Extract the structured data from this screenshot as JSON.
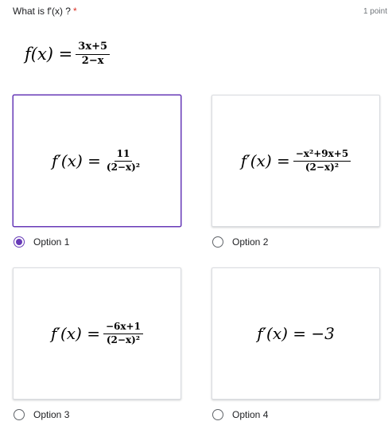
{
  "question": {
    "title": "What is f'(x) ?",
    "required_mark": "*",
    "points": "1 point",
    "expression_lhs": "f(x) =",
    "numerator": "3x+5",
    "denominator": "2−x"
  },
  "options": [
    {
      "label": "Option 1",
      "selected": true,
      "lhs": "f′(x) =",
      "numerator": "11",
      "denominator": "(2−x)²"
    },
    {
      "label": "Option 2",
      "selected": false,
      "lhs": "f′(x) =",
      "numerator": "−x²+9x+5",
      "denominator": "(2−x)²"
    },
    {
      "label": "Option 3",
      "selected": false,
      "lhs": "f′(x) =",
      "numerator": "−6x+1",
      "denominator": "(2−x)²"
    },
    {
      "label": "Option 4",
      "selected": false,
      "expression": "f′(x) = −3"
    }
  ],
  "colors": {
    "accent": "#673ab7",
    "required": "#d93025",
    "muted": "#70757a"
  }
}
